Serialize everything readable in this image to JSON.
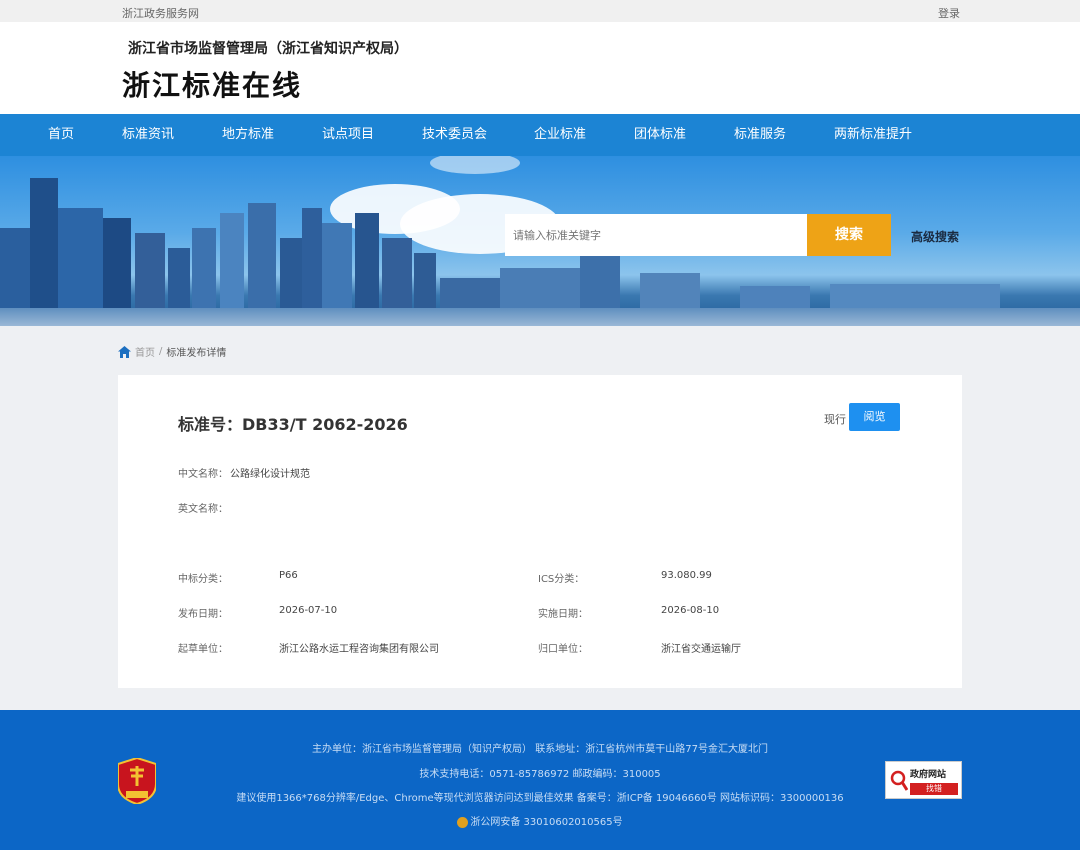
{
  "topbar": {
    "left": "浙江政务服务网",
    "right": "登录"
  },
  "header": {
    "org": "浙江省市场监督管理局（浙江省知识产权局）",
    "site": "浙江标准在线"
  },
  "nav": [
    "首页",
    "标准资讯",
    "地方标准",
    "试点项目",
    "技术委员会",
    "企业标准",
    "团体标准",
    "标准服务",
    "两新标准提升"
  ],
  "search": {
    "placeholder": "请输入标准关键字",
    "button": "搜索",
    "advanced": "高级搜索"
  },
  "breadcrumb": {
    "home": "首页",
    "sep": "/",
    "current": "标准发布详情"
  },
  "detail": {
    "std_no": "标准号：DB33/T 2062-2026",
    "status": "现行",
    "view": "阅览",
    "cn_label": "中文名称：",
    "cn_value": "公路绿化设计规范",
    "en_label": "英文名称：",
    "en_value": "",
    "ccs_label": "中标分类：",
    "ccs_value": "P66",
    "ics_label": "ICS分类：",
    "ics_value": "93.080.99",
    "pub_label": "发布日期：",
    "pub_value": "2026-07-10",
    "impl_label": "实施日期：",
    "impl_value": "2026-08-10",
    "draft_label": "起草单位：",
    "draft_value": "浙江公路水运工程咨询集团有限公司",
    "dept_label": "归口单位：",
    "dept_value": "浙江省交通运输厅"
  },
  "footer": {
    "line1": "主办单位：浙江省市场监督管理局（知识产权局）     联系地址：浙江省杭州市莫干山路77号金汇大厦北门",
    "line2": "技术支持电话：0571-85786972     邮政编码：310005",
    "line3": "建议使用1366*768分辨率/Edge、Chrome等现代浏览器访问达到最佳效果   备案号：浙ICP备 19046660号  网站标识码：3300000136",
    "line4": "浙公网安备 33010602010565号",
    "gov_t1": "政府网站",
    "gov_t2": "找错"
  },
  "colors": {
    "nav": "#1c84d4",
    "search_button": "#eea316",
    "view_button": "#1e90f0",
    "footer": "#0c66c6"
  }
}
